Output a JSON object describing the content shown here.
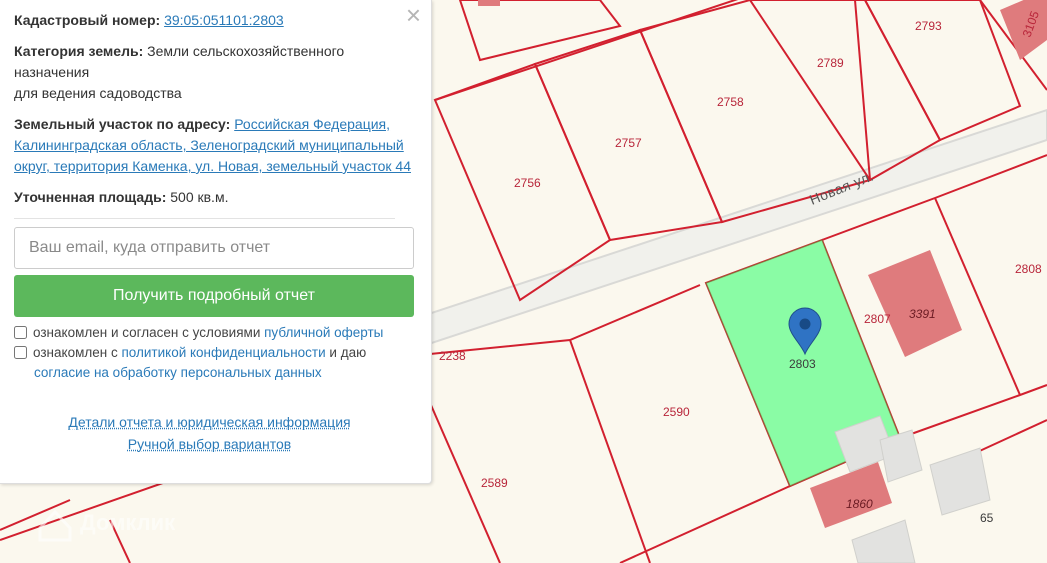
{
  "panel": {
    "close": "×",
    "cadastral_label": "Кадастровый номер:",
    "cadastral_value": "39:05:051101:2803",
    "category_label": "Категория земель:",
    "category_value": "Земли сельскохозяйственного назначения",
    "usage": "для ведения садоводства",
    "address_label": "Земельный участок по адресу:",
    "address_value": "Российская Федерация, Калининградская область, Зеленоградский муниципальный округ, территория Каменка, ул. Новая, земельный участок 44",
    "area_label": "Уточненная площадь:",
    "area_value": "500 кв.м.",
    "email_placeholder": "Ваш email, куда отправить отчет",
    "button_label": "Получить подробный отчет",
    "check1_text": "ознакомлен и согласен с условиями",
    "check1_link": "публичной оферты",
    "check2_text_a": "ознакомлен с",
    "check2_link1": "политикой конфиденциальности",
    "check2_text_b": "и даю",
    "check2_link2": "согласие на обработку персональных данных",
    "link_details": "Детали отчета и юридическая информация",
    "link_manual": "Ручной выбор вариантов"
  },
  "map": {
    "street_name": "Новая ул.",
    "watermark": "Домклик",
    "highlight_color": "#7dfc9c",
    "boundary_color": "#d2202f",
    "building_color": "#df7b7d",
    "selected_plot": "2803",
    "plots": [
      "2793",
      "2789",
      "2758",
      "2757",
      "2756",
      "2808",
      "2807",
      "2590",
      "2589",
      "2238",
      "65",
      "3105"
    ],
    "buildings": [
      "3391",
      "1860"
    ],
    "marker": "map-pin-icon"
  }
}
